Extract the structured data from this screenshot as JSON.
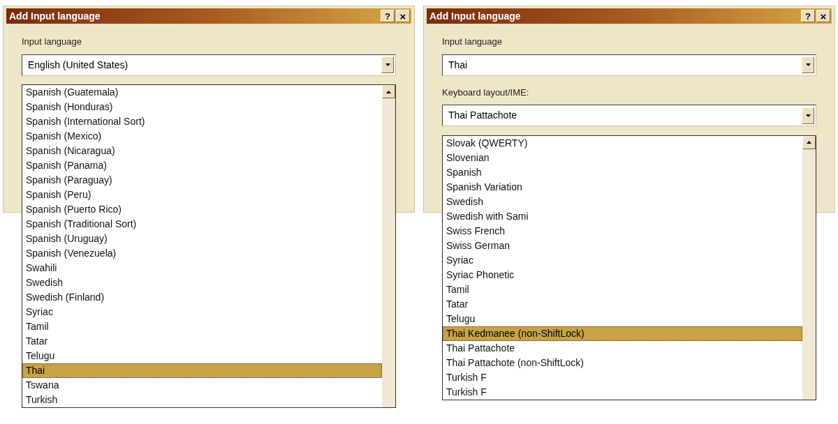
{
  "dialogs": [
    {
      "title": "Add Input language",
      "help": "?",
      "close": "×",
      "fields": [
        {
          "label": "Input language",
          "value": "English (United States)"
        }
      ],
      "list": {
        "items": [
          {
            "label": "Spanish (Guatemala)",
            "selected": false
          },
          {
            "label": "Spanish (Honduras)",
            "selected": false
          },
          {
            "label": "Spanish (International Sort)",
            "selected": false
          },
          {
            "label": "Spanish (Mexico)",
            "selected": false
          },
          {
            "label": "Spanish (Nicaragua)",
            "selected": false
          },
          {
            "label": "Spanish (Panama)",
            "selected": false
          },
          {
            "label": "Spanish (Paraguay)",
            "selected": false
          },
          {
            "label": "Spanish (Peru)",
            "selected": false
          },
          {
            "label": "Spanish (Puerto Rico)",
            "selected": false
          },
          {
            "label": "Spanish (Traditional Sort)",
            "selected": false
          },
          {
            "label": "Spanish (Uruguay)",
            "selected": false
          },
          {
            "label": "Spanish (Venezuela)",
            "selected": false
          },
          {
            "label": "Swahili",
            "selected": false
          },
          {
            "label": "Swedish",
            "selected": false
          },
          {
            "label": "Swedish (Finland)",
            "selected": false
          },
          {
            "label": "Syriac",
            "selected": false
          },
          {
            "label": "Tamil",
            "selected": false
          },
          {
            "label": "Tatar",
            "selected": false
          },
          {
            "label": "Telugu",
            "selected": false
          },
          {
            "label": "Thai",
            "selected": true
          },
          {
            "label": "Tswana",
            "selected": false
          },
          {
            "label": "Turkish",
            "selected": false
          }
        ]
      }
    },
    {
      "title": "Add Input language",
      "help": "?",
      "close": "×",
      "fields": [
        {
          "label": "Input language",
          "value": "Thai"
        },
        {
          "label": "Keyboard layout/IME:",
          "value": "Thai Pattachote"
        }
      ],
      "list": {
        "items": [
          {
            "label": "Slovak (QWERTY)",
            "selected": false
          },
          {
            "label": "Slovenian",
            "selected": false
          },
          {
            "label": "Spanish",
            "selected": false
          },
          {
            "label": "Spanish Variation",
            "selected": false
          },
          {
            "label": "Swedish",
            "selected": false
          },
          {
            "label": "Swedish with Sami",
            "selected": false
          },
          {
            "label": "Swiss French",
            "selected": false
          },
          {
            "label": "Swiss German",
            "selected": false
          },
          {
            "label": "Syriac",
            "selected": false
          },
          {
            "label": "Syriac Phonetic",
            "selected": false
          },
          {
            "label": "Tamil",
            "selected": false
          },
          {
            "label": "Tatar",
            "selected": false
          },
          {
            "label": "Telugu",
            "selected": false
          },
          {
            "label": "Thai Kedmanee (non-ShiftLock)",
            "selected": true
          },
          {
            "label": "Thai Pattachote",
            "selected": false
          },
          {
            "label": "Thai Pattachote (non-ShiftLock)",
            "selected": false
          },
          {
            "label": "Turkish F",
            "selected": false
          },
          {
            "label": "Turkish F",
            "selected": false
          }
        ]
      }
    }
  ]
}
